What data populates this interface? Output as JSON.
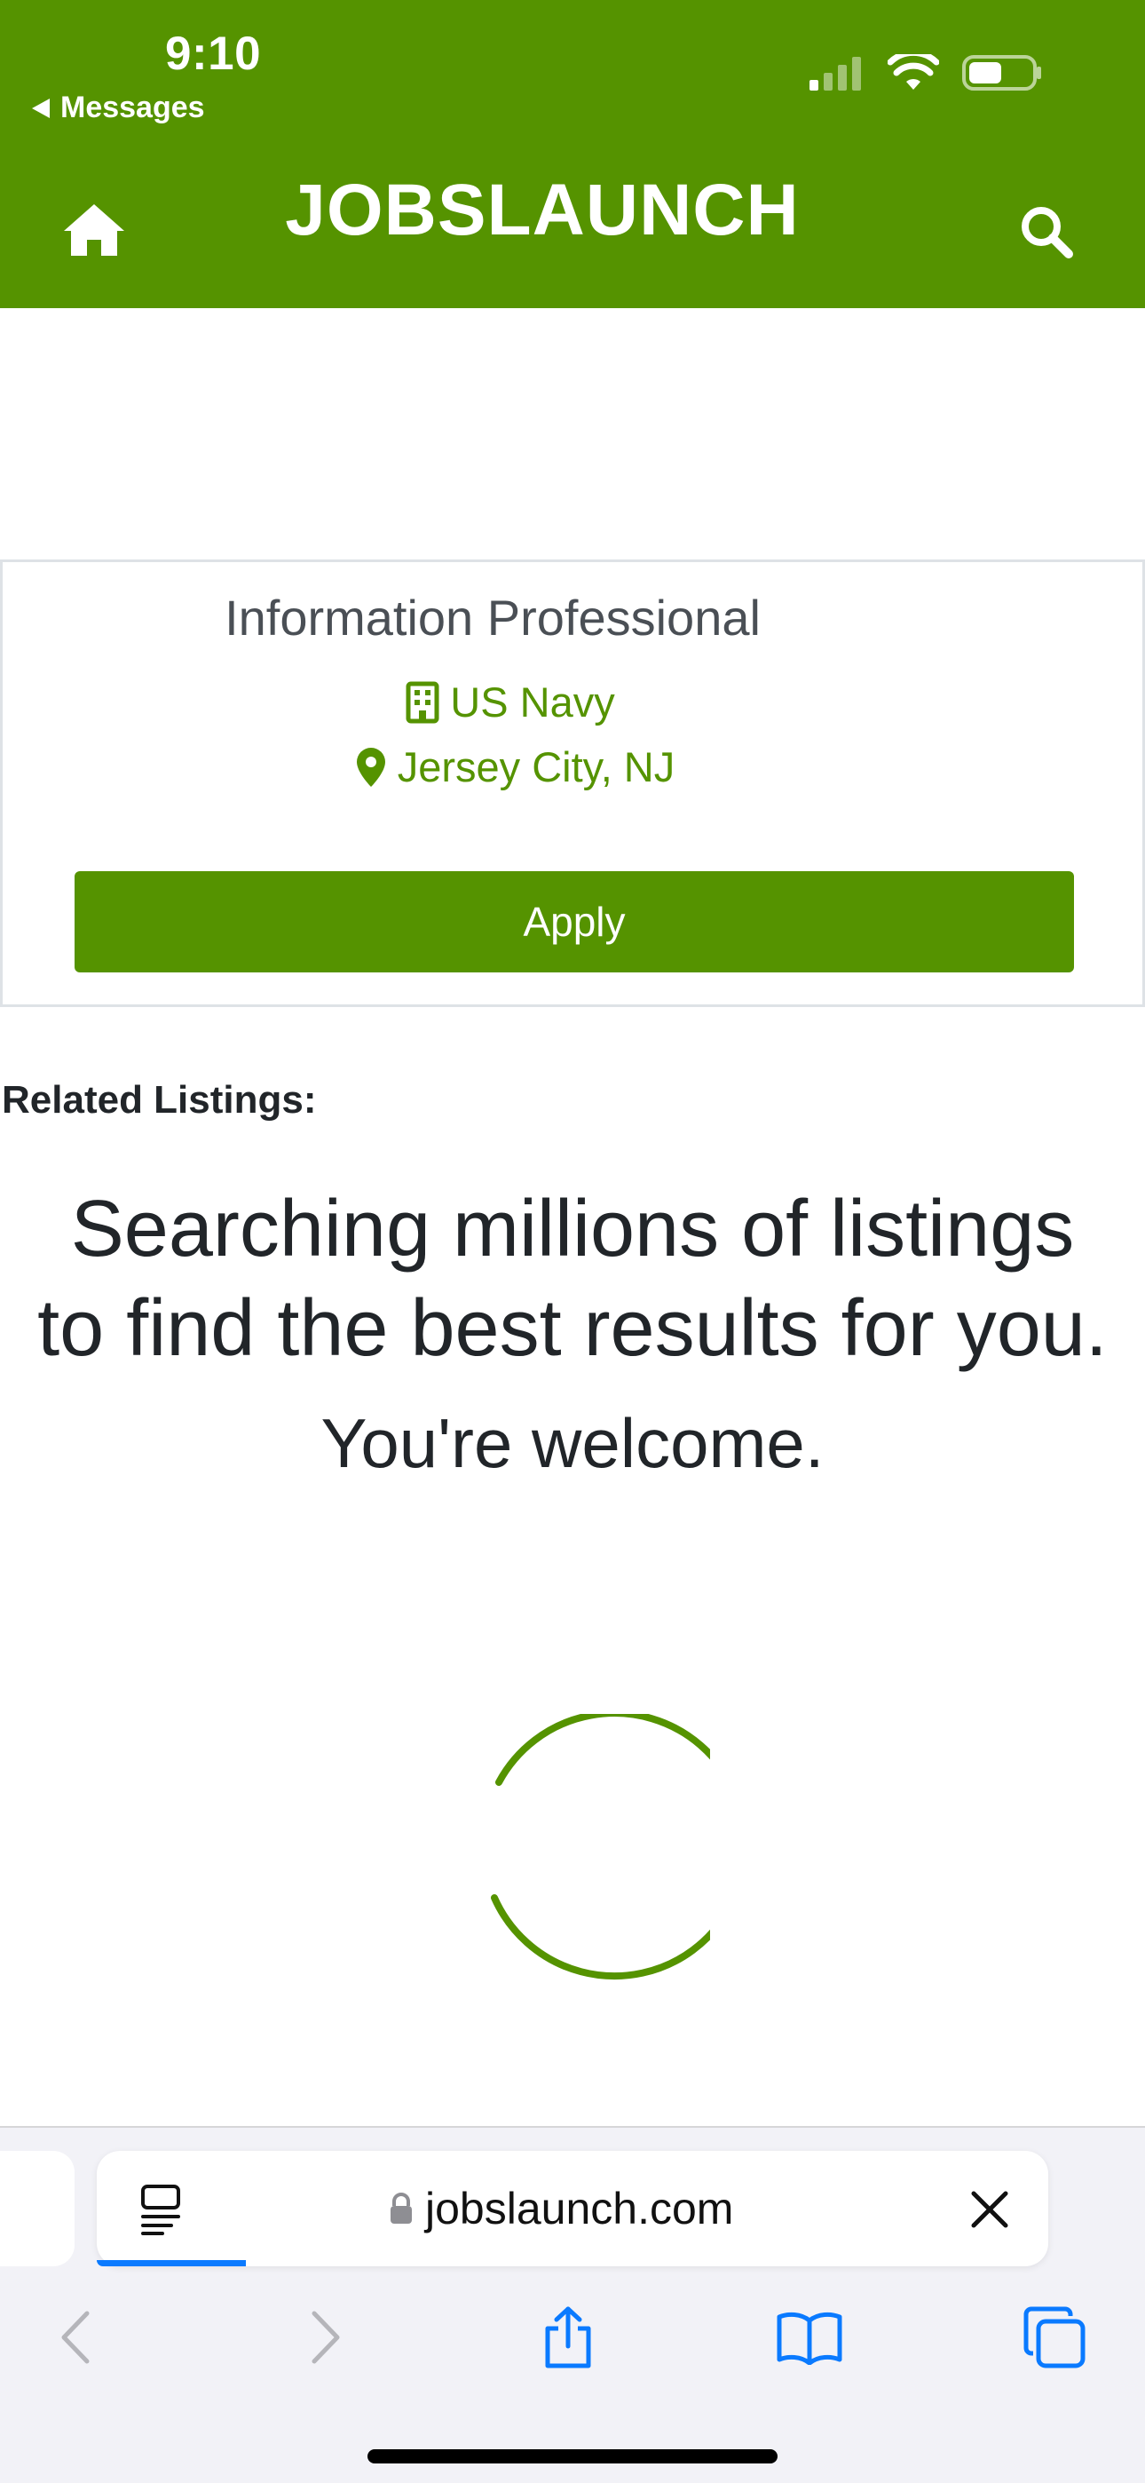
{
  "status_bar": {
    "time": "9:10",
    "back_app": "Messages"
  },
  "header": {
    "brand": "JOBSLAUNCH",
    "home_icon": "home-icon",
    "search_icon": "search-icon",
    "color": "#559300"
  },
  "job": {
    "title": "Information Professional",
    "company": "US Navy",
    "location": "Jersey City, NJ",
    "apply_label": "Apply"
  },
  "related": {
    "heading": "Related Listings:",
    "loading_line1": "Searching millions of listings",
    "loading_line2": "to find the best results for you.",
    "welcome": "You're welcome."
  },
  "browser": {
    "url": "jobslaunch.com",
    "link_color": "#0a7aff"
  }
}
